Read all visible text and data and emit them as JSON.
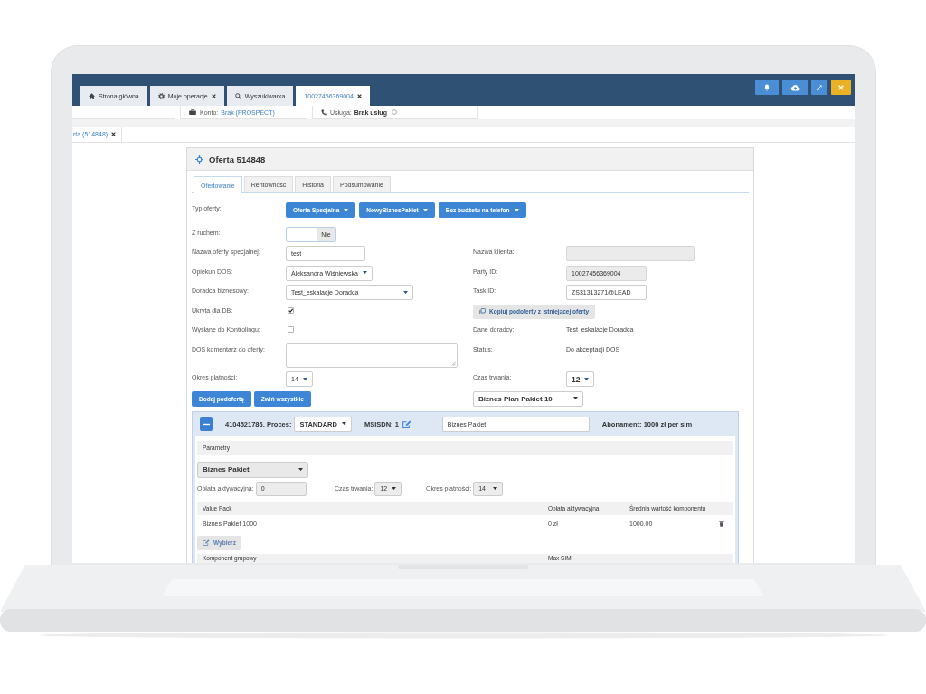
{
  "top_bar": {
    "tabs": [
      {
        "label": "Strona główna",
        "closable": false,
        "selected": false
      },
      {
        "label": "Moje operacje",
        "closable": true,
        "selected": false
      },
      {
        "label": "Wyszukiwarka",
        "closable": false,
        "selected": false
      },
      {
        "label": "10027456369004",
        "closable": true,
        "selected": true
      }
    ]
  },
  "info_bar": {
    "fields": [
      {
        "kind": "account",
        "label": "Konto:",
        "value": "Brak (PROSPECT)"
      },
      {
        "kind": "service",
        "label": "Usługa:",
        "value": "Brak usług"
      }
    ]
  },
  "sub_tabs": [
    {
      "label": "rta (514848)",
      "closable": true,
      "selected": true
    }
  ],
  "panel": {
    "title": "Oferta 514848",
    "tabs": [
      {
        "label": "Ofertowanie",
        "selected": true
      },
      {
        "label": "Rentowność",
        "selected": false
      },
      {
        "label": "Historia",
        "selected": false
      },
      {
        "label": "Podsumowanie",
        "selected": false
      }
    ],
    "rows": [
      {
        "left": {
          "kind": "buttons",
          "label": "Typ oferty:",
          "buttons": [
            "Oferta Specjalna",
            "NowyBiznesPakiet",
            "Bez budżetu na telefon"
          ]
        }
      },
      {
        "left": {
          "kind": "switch",
          "label": "Z ruchem:",
          "value": "Nie",
          "on": false
        }
      },
      {
        "left": {
          "kind": "input",
          "label": "Nazwa oferty specjalnej:",
          "value": "test",
          "disabled": false
        },
        "right": {
          "kind": "input",
          "label": "Nazwa klienta:",
          "disabled": true
        }
      },
      {
        "left": {
          "kind": "select",
          "label": "Opiekun DOS:",
          "value": "Aleksandra Wiśniewska"
        },
        "right": {
          "kind": "input",
          "label": "Party ID:",
          "value": "10027456369004",
          "disabled": true
        }
      },
      {
        "left": {
          "kind": "select",
          "label": "Doradca biznesowy:",
          "value": "Test_eskalacje Doradca"
        },
        "right": {
          "kind": "input",
          "label": "Task ID:",
          "value": "ZS31313271@LEAD",
          "disabled": false
        }
      },
      {
        "left": {
          "kind": "checkbox",
          "label": "Ukryta dla DB:",
          "checked": true
        },
        "right": {
          "kind": "button",
          "text": "Kopiuj podoferty z istniejącej oferty"
        }
      },
      {
        "left": {
          "kind": "checkbox",
          "label": "Wysłane do Kontrolingu:",
          "checked": false
        },
        "right": {
          "kind": "text",
          "label": "Dane doradcy:",
          "value": "Test_eskalacje Doradca"
        }
      },
      {
        "left": {
          "kind": "textarea",
          "label": "DOS komentarz do oferty:"
        },
        "right": {
          "kind": "text",
          "label": "Status:",
          "value": "Do akceptacji DOS"
        }
      },
      {
        "left": {
          "kind": "select",
          "label": "Okres płatności:",
          "value": "14"
        },
        "right": {
          "kind": "select",
          "label": "Czas trwania:",
          "value": "12"
        }
      }
    ],
    "actions": {
      "buttons": [
        "Dodaj podofertę",
        "Zwiń wszystkie"
      ],
      "plan": "Biznes Plan Pakiet 10"
    },
    "sub_offer": {
      "expanded": true,
      "number": "4104521786. Proces:",
      "process": "STANDARD",
      "msisdn": "MSISDN: 1",
      "name": "Biznes Pakiet",
      "subscription": "Abonament: 1000 zł per sim",
      "params_title": "Parametry",
      "package": "Biznes Pakiet",
      "params": [
        {
          "kind": "input",
          "label": "Opłata aktywacyjna:",
          "value": "0"
        },
        {
          "kind": "select",
          "label": "Czas trwania:",
          "value": "12"
        },
        {
          "kind": "select",
          "label": "Okres płatności:",
          "value": "14"
        }
      ],
      "table": {
        "columns": [
          "Value Pack",
          "Opłata aktywacyjna",
          "Średnia wartość komponentu"
        ],
        "rows": [
          [
            "Biznes Pakiet 1000",
            "0 zł",
            "1000.00"
          ]
        ]
      },
      "choose_button": "Wybierz",
      "table_2": {
        "columns": [
          "Komponent grupowy",
          "Max SIM"
        ]
      }
    }
  }
}
